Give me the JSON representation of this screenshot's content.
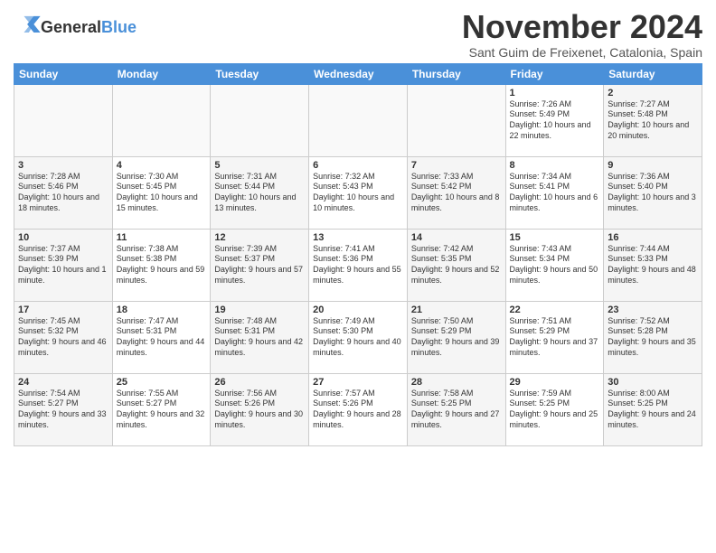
{
  "logo": {
    "general": "General",
    "blue": "Blue"
  },
  "title": "November 2024",
  "location": "Sant Guim de Freixenet, Catalonia, Spain",
  "days_of_week": [
    "Sunday",
    "Monday",
    "Tuesday",
    "Wednesday",
    "Thursday",
    "Friday",
    "Saturday"
  ],
  "weeks": [
    [
      {
        "day": "",
        "info": ""
      },
      {
        "day": "",
        "info": ""
      },
      {
        "day": "",
        "info": ""
      },
      {
        "day": "",
        "info": ""
      },
      {
        "day": "",
        "info": ""
      },
      {
        "day": "1",
        "info": "Sunrise: 7:26 AM\nSunset: 5:49 PM\nDaylight: 10 hours and 22 minutes."
      },
      {
        "day": "2",
        "info": "Sunrise: 7:27 AM\nSunset: 5:48 PM\nDaylight: 10 hours and 20 minutes."
      }
    ],
    [
      {
        "day": "3",
        "info": "Sunrise: 7:28 AM\nSunset: 5:46 PM\nDaylight: 10 hours and 18 minutes."
      },
      {
        "day": "4",
        "info": "Sunrise: 7:30 AM\nSunset: 5:45 PM\nDaylight: 10 hours and 15 minutes."
      },
      {
        "day": "5",
        "info": "Sunrise: 7:31 AM\nSunset: 5:44 PM\nDaylight: 10 hours and 13 minutes."
      },
      {
        "day": "6",
        "info": "Sunrise: 7:32 AM\nSunset: 5:43 PM\nDaylight: 10 hours and 10 minutes."
      },
      {
        "day": "7",
        "info": "Sunrise: 7:33 AM\nSunset: 5:42 PM\nDaylight: 10 hours and 8 minutes."
      },
      {
        "day": "8",
        "info": "Sunrise: 7:34 AM\nSunset: 5:41 PM\nDaylight: 10 hours and 6 minutes."
      },
      {
        "day": "9",
        "info": "Sunrise: 7:36 AM\nSunset: 5:40 PM\nDaylight: 10 hours and 3 minutes."
      }
    ],
    [
      {
        "day": "10",
        "info": "Sunrise: 7:37 AM\nSunset: 5:39 PM\nDaylight: 10 hours and 1 minute."
      },
      {
        "day": "11",
        "info": "Sunrise: 7:38 AM\nSunset: 5:38 PM\nDaylight: 9 hours and 59 minutes."
      },
      {
        "day": "12",
        "info": "Sunrise: 7:39 AM\nSunset: 5:37 PM\nDaylight: 9 hours and 57 minutes."
      },
      {
        "day": "13",
        "info": "Sunrise: 7:41 AM\nSunset: 5:36 PM\nDaylight: 9 hours and 55 minutes."
      },
      {
        "day": "14",
        "info": "Sunrise: 7:42 AM\nSunset: 5:35 PM\nDaylight: 9 hours and 52 minutes."
      },
      {
        "day": "15",
        "info": "Sunrise: 7:43 AM\nSunset: 5:34 PM\nDaylight: 9 hours and 50 minutes."
      },
      {
        "day": "16",
        "info": "Sunrise: 7:44 AM\nSunset: 5:33 PM\nDaylight: 9 hours and 48 minutes."
      }
    ],
    [
      {
        "day": "17",
        "info": "Sunrise: 7:45 AM\nSunset: 5:32 PM\nDaylight: 9 hours and 46 minutes."
      },
      {
        "day": "18",
        "info": "Sunrise: 7:47 AM\nSunset: 5:31 PM\nDaylight: 9 hours and 44 minutes."
      },
      {
        "day": "19",
        "info": "Sunrise: 7:48 AM\nSunset: 5:31 PM\nDaylight: 9 hours and 42 minutes."
      },
      {
        "day": "20",
        "info": "Sunrise: 7:49 AM\nSunset: 5:30 PM\nDaylight: 9 hours and 40 minutes."
      },
      {
        "day": "21",
        "info": "Sunrise: 7:50 AM\nSunset: 5:29 PM\nDaylight: 9 hours and 39 minutes."
      },
      {
        "day": "22",
        "info": "Sunrise: 7:51 AM\nSunset: 5:29 PM\nDaylight: 9 hours and 37 minutes."
      },
      {
        "day": "23",
        "info": "Sunrise: 7:52 AM\nSunset: 5:28 PM\nDaylight: 9 hours and 35 minutes."
      }
    ],
    [
      {
        "day": "24",
        "info": "Sunrise: 7:54 AM\nSunset: 5:27 PM\nDaylight: 9 hours and 33 minutes."
      },
      {
        "day": "25",
        "info": "Sunrise: 7:55 AM\nSunset: 5:27 PM\nDaylight: 9 hours and 32 minutes."
      },
      {
        "day": "26",
        "info": "Sunrise: 7:56 AM\nSunset: 5:26 PM\nDaylight: 9 hours and 30 minutes."
      },
      {
        "day": "27",
        "info": "Sunrise: 7:57 AM\nSunset: 5:26 PM\nDaylight: 9 hours and 28 minutes."
      },
      {
        "day": "28",
        "info": "Sunrise: 7:58 AM\nSunset: 5:25 PM\nDaylight: 9 hours and 27 minutes."
      },
      {
        "day": "29",
        "info": "Sunrise: 7:59 AM\nSunset: 5:25 PM\nDaylight: 9 hours and 25 minutes."
      },
      {
        "day": "30",
        "info": "Sunrise: 8:00 AM\nSunset: 5:25 PM\nDaylight: 9 hours and 24 minutes."
      }
    ]
  ]
}
